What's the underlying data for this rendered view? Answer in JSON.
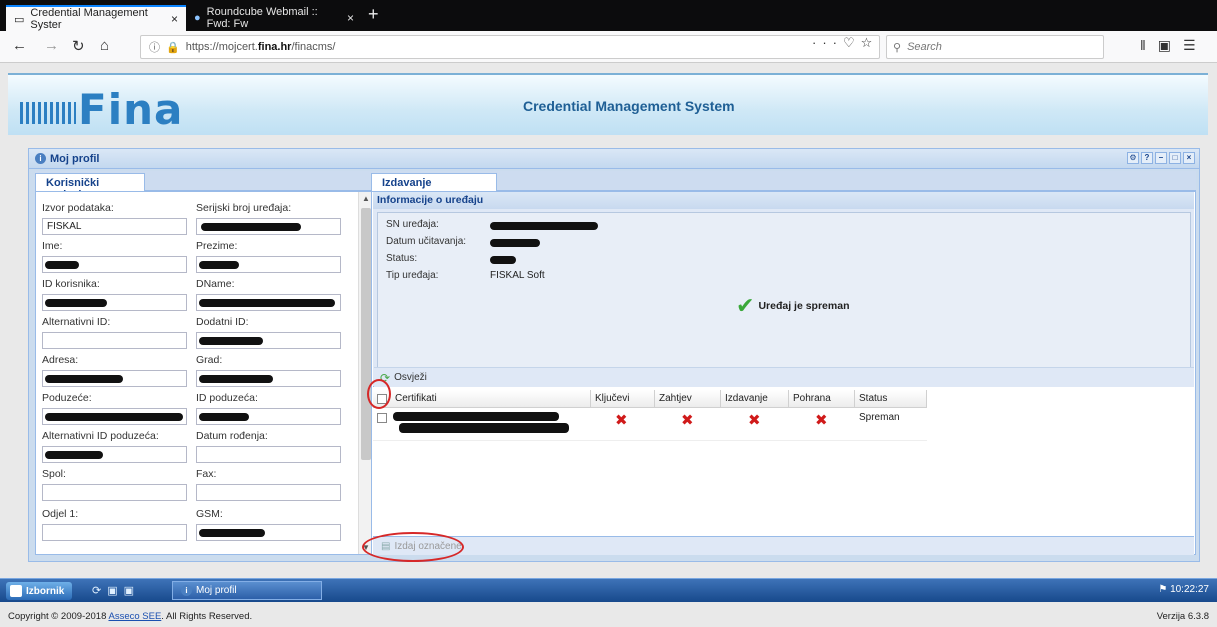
{
  "browser": {
    "tabs": [
      {
        "title": "Credential Management Syster",
        "active": true
      },
      {
        "title": "Roundcube Webmail :: Fwd: Fw",
        "active": false
      }
    ],
    "new_tab": "+",
    "tab_close": "×",
    "url_prefix": "https://mojcert.",
    "url_domain": "fina.hr",
    "url_suffix": "/finacms/",
    "search_placeholder": "Search"
  },
  "app": {
    "logo_text": "Fina",
    "title": "Credential Management System"
  },
  "window": {
    "title": "Moj profil",
    "left_tab": "Korisnički podaci",
    "right_tab": "Izdavanje"
  },
  "profile_fields": [
    {
      "label": "Izvor podataka:",
      "value": "FISKAL"
    },
    {
      "label": "Serijski broj uređaja:",
      "value": ""
    },
    {
      "label": "Ime:",
      "value": ""
    },
    {
      "label": "Prezime:",
      "value": ""
    },
    {
      "label": "ID korisnika:",
      "value": ""
    },
    {
      "label": "DName:",
      "value": ""
    },
    {
      "label": "Alternativni ID:",
      "value": ""
    },
    {
      "label": "Dodatni ID:",
      "value": ""
    },
    {
      "label": "Adresa:",
      "value": ""
    },
    {
      "label": "Grad:",
      "value": ""
    },
    {
      "label": "Poduzeće:",
      "value": ""
    },
    {
      "label": "ID poduzeća:",
      "value": ""
    },
    {
      "label": "Alternativni ID poduzeća:",
      "value": ""
    },
    {
      "label": "Datum rođenja:",
      "value": ""
    },
    {
      "label": "Spol:",
      "value": ""
    },
    {
      "label": "Fax:",
      "value": ""
    },
    {
      "label": "Odjel 1:",
      "value": ""
    },
    {
      "label": "GSM:",
      "value": ""
    }
  ],
  "device_info": {
    "header": "Informacije o uređaju",
    "labels": [
      "SN uređaja:",
      "Datum učitavanja:",
      "Status:",
      "Tip uređaja:"
    ],
    "device_type": "FISKAL Soft",
    "ready_text": "Uređaj je spreman"
  },
  "refresh_label": "Osvježi",
  "grid": {
    "columns": [
      "Certifikati",
      "Ključevi",
      "Zahtjev",
      "Izdavanje",
      "Pohrana",
      "Status"
    ],
    "row_status": "Spreman"
  },
  "issue_button": "Izdaj označene",
  "taskbar": {
    "start_label": "Izbornik",
    "window_label": "Moj profil",
    "clock": "10:22:27"
  },
  "footer": {
    "copyright_prefix": "Copyright © 2009-2018 ",
    "company": "Asseco SEE",
    "copyright_suffix": ". All Rights Reserved.",
    "version": "Verzija 6.3.8"
  },
  "colors": {
    "accent": "#15428b",
    "panel_border": "#99bbe8",
    "error_mark": "#d01a1a",
    "ok_mark": "#3aa83a",
    "annotation": "#d62828"
  }
}
